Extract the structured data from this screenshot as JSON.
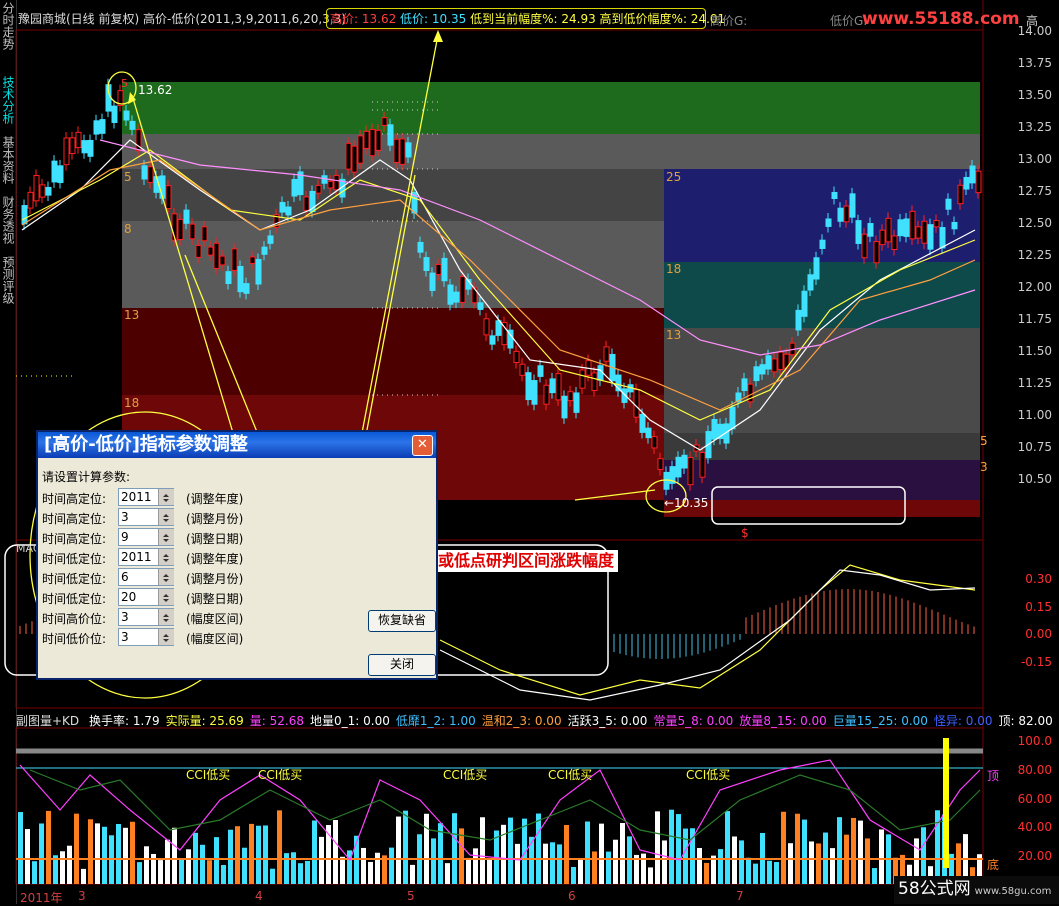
{
  "sidebar": {
    "items": [
      {
        "label": "分时走势",
        "active": false
      },
      {
        "label": "技术分析",
        "active": true
      },
      {
        "label": "基本资料",
        "active": false
      },
      {
        "label": "财务透视",
        "active": false
      },
      {
        "label": "预测评级",
        "active": false
      }
    ]
  },
  "title_bar": {
    "stock": "豫园商城(日线 前复权)",
    "indicator": "高价-低价(2011,3,9,2011,6,20,3,3)"
  },
  "legend": {
    "high": "高价: 13.62",
    "low": "低价: 10.35",
    "low_to_now": "低到当前幅度%: 24.93",
    "high_to_low": "高到低价幅度%: 24.01",
    "high_g": "高价G:",
    "low_g": "低价G:",
    "high_right": "高"
  },
  "logo": {
    "text": "www.55188.com"
  },
  "price_axis": [
    "14.00",
    "13.75",
    "13.50",
    "13.25",
    "13.00",
    "12.75",
    "12.50",
    "12.25",
    "12.00",
    "11.75",
    "11.50",
    "11.25",
    "11.00",
    "10.75",
    "10.50"
  ],
  "zones_left": [
    {
      "label": "5",
      "color": "#1e6b1e"
    },
    {
      "label": "8",
      "color": "#5a5a5a"
    },
    {
      "label": "13",
      "color": "#5a0000"
    },
    {
      "label": "18",
      "color": "#6e0808"
    }
  ],
  "zones_right": [
    {
      "label": "25",
      "color": "#1e1e6e"
    },
    {
      "label": "18",
      "color": "#0f4a4a"
    },
    {
      "label": "13",
      "color": "#4a4a4a"
    }
  ],
  "chart_labels": {
    "high_mark": "13.62",
    "low_mark": "←10.35",
    "peak_digit": "5",
    "right_five": "5",
    "right_three": "3",
    "dollar": "$"
  },
  "annotation": "调整所需要的时间的高点或低点研判区间涨跌幅度",
  "dialog": {
    "title": "[高价-低价]指标参数调整",
    "prompt": "请设置计算参数:",
    "rows": [
      {
        "label": "时间高定位:",
        "value": "2011",
        "hint": "(调整年度)"
      },
      {
        "label": "时间高定位:",
        "value": "3",
        "hint": "(调整月份)"
      },
      {
        "label": "时间高定位:",
        "value": "9",
        "hint": "(调整日期)"
      },
      {
        "label": "时间低定位:",
        "value": "2011",
        "hint": "(调整年度)"
      },
      {
        "label": "时间低定位:",
        "value": "6",
        "hint": "(调整月份)"
      },
      {
        "label": "时间低定位:",
        "value": "20",
        "hint": "(调整日期)"
      },
      {
        "label": "时间高价位:",
        "value": "3",
        "hint": "(幅度区间)"
      },
      {
        "label": "时间低价位:",
        "value": "3",
        "hint": "(幅度区间)"
      }
    ],
    "reset_button": "恢复缺省",
    "close_button": "关闭"
  },
  "macd": {
    "label": "MAC",
    "axis": [
      "0.30",
      "0.15",
      "0.00",
      "-0.15"
    ]
  },
  "volume_header": {
    "name": "副图量+KD",
    "items": [
      {
        "text": "换手率: 1.79",
        "color": "#ffffff"
      },
      {
        "text": "实际量: 25.69",
        "color": "#ffff40"
      },
      {
        "text": "量: 52.68",
        "color": "#ff40ff"
      },
      {
        "text": "地量0_1: 0.00",
        "color": "#ffffff"
      },
      {
        "text": "低靡1_2: 1.00",
        "color": "#40c0ff"
      },
      {
        "text": "温和2_3: 0.00",
        "color": "#ffa040"
      },
      {
        "text": "活跃3_5: 0.00",
        "color": "#ffffff"
      },
      {
        "text": "常量5_8: 0.00",
        "color": "#ff40ff"
      },
      {
        "text": "放量8_15: 0.00",
        "color": "#ff40ff"
      },
      {
        "text": "巨量15_25: 0.00",
        "color": "#40c0ff"
      },
      {
        "text": "怪异: 0.00",
        "color": "#4060ff"
      },
      {
        "text": "顶: 82.00",
        "color": "#ffffff"
      }
    ]
  },
  "kd_axis": [
    "100.0",
    "80.00",
    "60.00",
    "40.00",
    "20.00"
  ],
  "kd_labels": {
    "top": "顶",
    "bottom": "底",
    "cci": "CCI低买"
  },
  "dates": [
    {
      "label": "2011年"
    },
    {
      "label": "3"
    },
    {
      "label": "4"
    },
    {
      "label": "5"
    },
    {
      "label": "6"
    },
    {
      "label": "7"
    }
  ],
  "watermark": {
    "text": "58公式网",
    "url": "www.58gu.com"
  }
}
